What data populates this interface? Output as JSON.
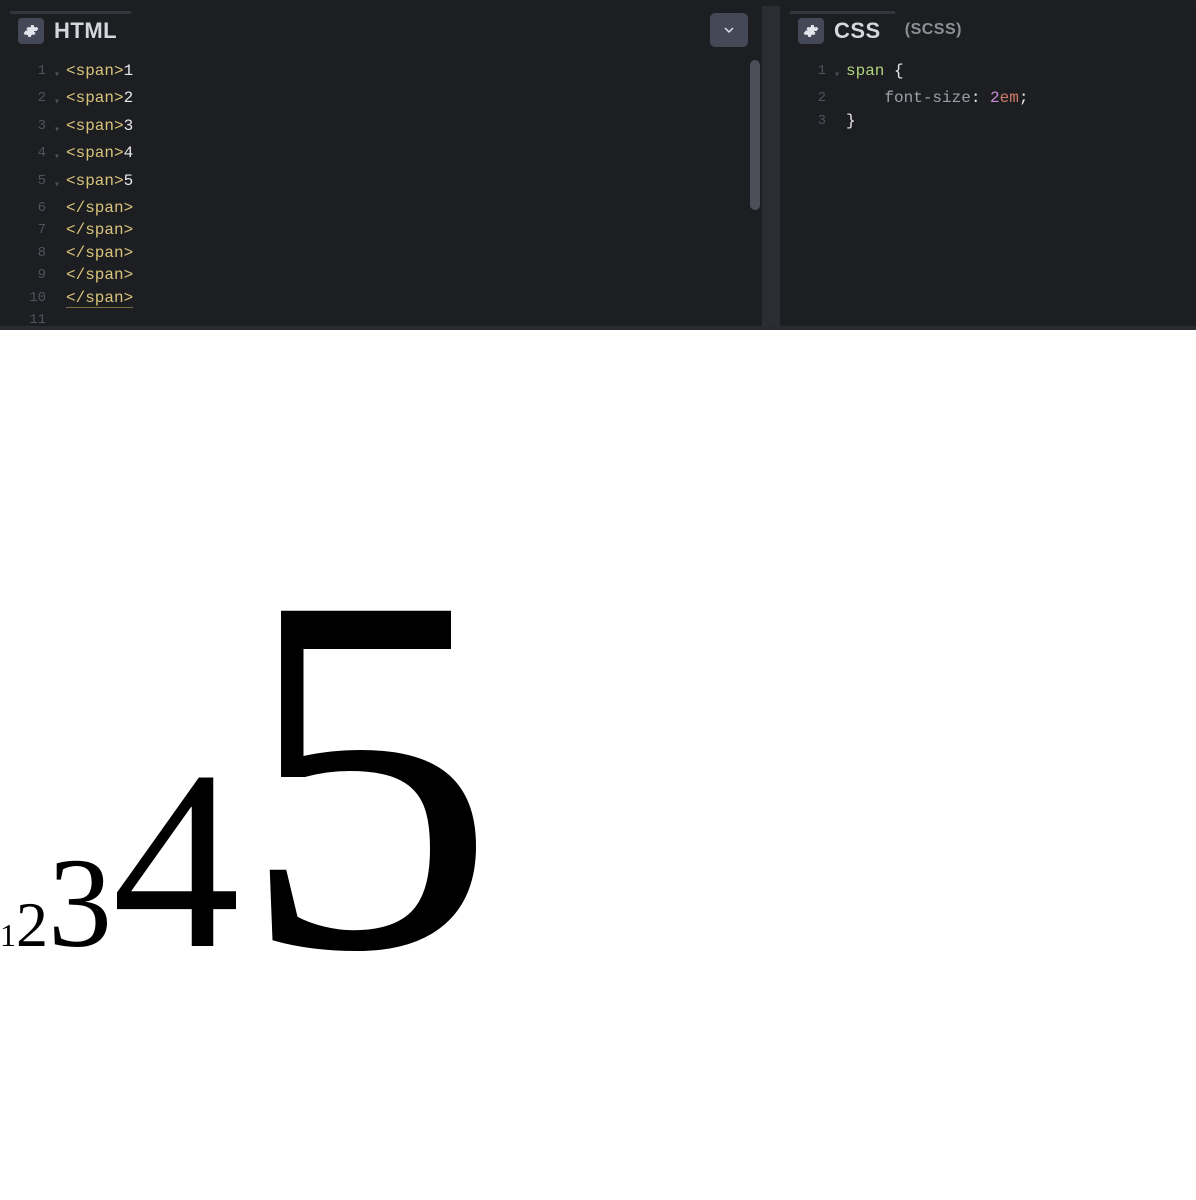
{
  "panes": {
    "html": {
      "title": "HTML",
      "lines": [
        {
          "ln": "1",
          "fold": "▾",
          "tag": "<span>",
          "txt": "1",
          "close": ""
        },
        {
          "ln": "2",
          "fold": "▾",
          "tag": "<span>",
          "txt": "2",
          "close": ""
        },
        {
          "ln": "3",
          "fold": "▾",
          "tag": "<span>",
          "txt": "3",
          "close": ""
        },
        {
          "ln": "4",
          "fold": "▾",
          "tag": "<span>",
          "txt": "4",
          "close": ""
        },
        {
          "ln": "5",
          "fold": "▾",
          "tag": "<span>",
          "txt": "5",
          "close": ""
        },
        {
          "ln": "6",
          "fold": "",
          "tag": "</span>",
          "txt": "",
          "close": ""
        },
        {
          "ln": "7",
          "fold": "",
          "tag": "</span>",
          "txt": "",
          "close": ""
        },
        {
          "ln": "8",
          "fold": "",
          "tag": "</span>",
          "txt": "",
          "close": ""
        },
        {
          "ln": "9",
          "fold": "",
          "tag": "</span>",
          "txt": "",
          "close": ""
        },
        {
          "ln": "10",
          "fold": "",
          "tag": "</span>",
          "txt": "",
          "close": "",
          "underline": true
        },
        {
          "ln": "11",
          "fold": "",
          "tag": "",
          "txt": "",
          "close": ""
        }
      ]
    },
    "css": {
      "title": "CSS",
      "subtitle": "(SCSS)",
      "lines": [
        {
          "ln": "1",
          "fold": "▾",
          "sel": "span ",
          "brace": "{"
        },
        {
          "ln": "2",
          "fold": "",
          "indent": "    ",
          "prop": "font-size",
          "colon": ": ",
          "num": "2",
          "unit": "em",
          "semi": ";"
        },
        {
          "ln": "3",
          "fold": "",
          "brace": "}"
        }
      ]
    }
  },
  "output": {
    "values": [
      "1",
      "2",
      "3",
      "4",
      "5"
    ]
  }
}
